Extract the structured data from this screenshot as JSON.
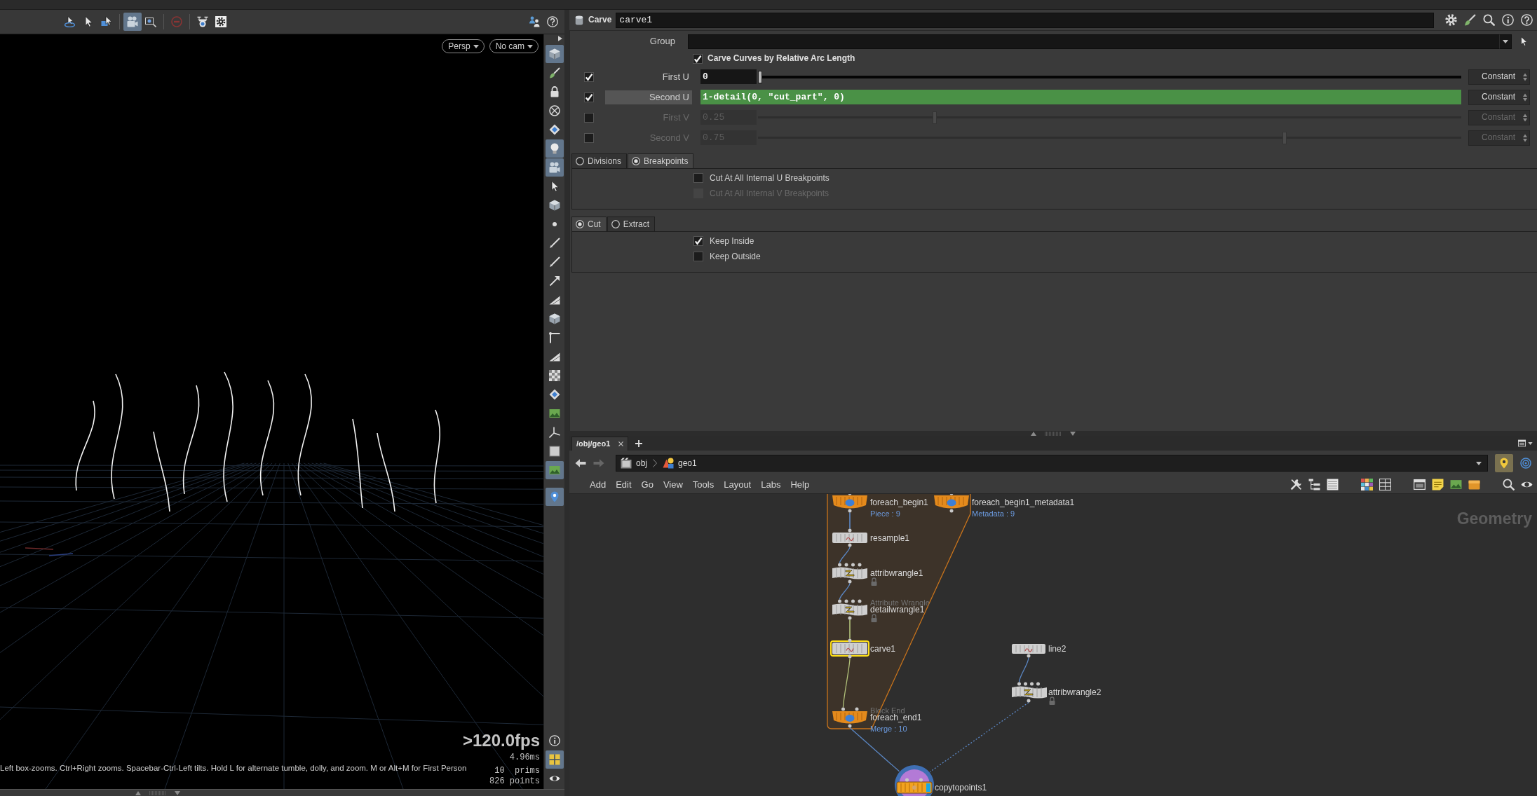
{
  "viewport": {
    "toolbar": [
      {
        "selected": false
      },
      {
        "selected": false
      },
      {
        "selected": false
      },
      {
        "selected": true
      },
      {
        "selected": false
      },
      {
        "selected": false
      },
      {
        "selected": false
      },
      {
        "selected": false
      },
      {
        "selected": false
      },
      {
        "selected": false
      }
    ],
    "view_menu": "Persp",
    "camera_menu": "No cam",
    "hint": "Left box-zooms. Ctrl+Right zooms. Spacebar-Ctrl-Left tilts. Hold L for alternate tumble, dolly, and zoom. M or Alt+M for First Person",
    "fps": ">120.0fps",
    "frame_time": "4.96ms",
    "prims": "10  prims",
    "points": "826 points",
    "side_toolbar": [
      {
        "selected": true
      },
      {
        "selected": false
      },
      {
        "selected": false
      },
      {
        "selected": false
      },
      {
        "selected": false
      },
      {
        "selected": true
      },
      {
        "selected": true
      },
      {
        "selected": false
      },
      {
        "selected": false
      },
      {
        "selected": false
      },
      {
        "selected": false
      },
      {
        "selected": false
      },
      {
        "selected": false
      },
      {
        "selected": false
      },
      {
        "selected": false
      },
      {
        "selected": false
      },
      {
        "selected": false
      },
      {
        "selected": false
      },
      {
        "selected": false
      },
      {
        "selected": false
      },
      {
        "selected": false
      },
      {
        "selected": false
      },
      {
        "selected": true
      },
      {
        "selected": true
      },
      {
        "selected": false
      },
      {
        "selected": true
      },
      {
        "selected": false
      }
    ]
  },
  "parameters": {
    "node_type": "Carve",
    "node_name": "carve1",
    "group": {
      "label": "Group"
    },
    "arc_length": {
      "label": "Carve Curves by Relative Arc Length",
      "checked": true
    },
    "rows": [
      {
        "label": "First U",
        "checked": true,
        "highlighted": false,
        "kind": "slider",
        "value": "0",
        "level": 0,
        "mode": "Constant"
      },
      {
        "label": "Second U",
        "checked": true,
        "highlighted": true,
        "kind": "expression",
        "value": "1-detail(0, \"cut_part\", 0)",
        "mode": "Constant"
      },
      {
        "label": "First V",
        "checked": false,
        "highlighted": false,
        "kind": "slider",
        "value": "0.25",
        "level": 0.25,
        "mode": "Constant"
      },
      {
        "label": "Second V",
        "checked": false,
        "highlighted": false,
        "kind": "slider",
        "value": "0.75",
        "level": 0.75,
        "mode": "Constant"
      }
    ],
    "domain_tabs": [
      {
        "label": "Divisions",
        "selected": false
      },
      {
        "label": "Breakpoints",
        "selected": true
      }
    ],
    "breakpoint_options": [
      {
        "label": "Cut At All Internal U Breakpoints",
        "checked": false,
        "disabled": false
      },
      {
        "label": "Cut At All Internal V Breakpoints",
        "checked": false,
        "disabled": true
      }
    ],
    "operation_tabs": [
      {
        "label": "Cut",
        "selected": true
      },
      {
        "label": "Extract",
        "selected": false
      }
    ],
    "keep_options": [
      {
        "label": "Keep Inside",
        "checked": true
      },
      {
        "label": "Keep Outside",
        "checked": false
      }
    ]
  },
  "network": {
    "tabs": [
      {
        "label": "/obj/geo1",
        "selected": true
      }
    ],
    "path": [
      "obj",
      "geo1"
    ],
    "menu": [
      "Add",
      "Edit",
      "Go",
      "View",
      "Tools",
      "Layout",
      "Labs",
      "Help"
    ],
    "context_label": "Geometry",
    "nodes": [
      {
        "name": "foreach_begin1",
        "kind": "block",
        "info": "Piece : 9",
        "selected": false,
        "display": false,
        "lock_badge": false
      },
      {
        "name": "foreach_begin1_metadata1",
        "kind": "block",
        "info": "Metadata : 9",
        "selected": false,
        "display": false,
        "lock_badge": false
      },
      {
        "name": "resample1",
        "kind": "sop",
        "selected": false,
        "display": false,
        "lock_badge": false
      },
      {
        "name": "attribwrangle1",
        "kind": "wrangle",
        "selected": false,
        "display": false,
        "lock_badge": true
      },
      {
        "name": "detailwrangle1",
        "kind": "wrangle",
        "type_label": "Attribute Wrangle",
        "selected": false,
        "display": false,
        "lock_badge": true
      },
      {
        "name": "carve1",
        "kind": "sop",
        "selected": true,
        "display": false,
        "lock_badge": false
      },
      {
        "name": "line2",
        "kind": "sop",
        "selected": false,
        "display": false,
        "lock_badge": false
      },
      {
        "name": "attribwrangle2",
        "kind": "wrangle",
        "selected": false,
        "display": false,
        "lock_badge": true
      },
      {
        "name": "foreach_end1",
        "kind": "block",
        "type_label": "Block End",
        "info": "Merge : 10",
        "selected": false,
        "display": false,
        "lock_badge": false
      },
      {
        "name": "copytopoints1",
        "kind": "copy",
        "selected": false,
        "display": true,
        "lock_badge": false
      }
    ],
    "wires": [
      {
        "dashed": false
      },
      {
        "dashed": false
      },
      {
        "dashed": false
      },
      {
        "dashed": false
      },
      {
        "dashed": false
      },
      {
        "dashed": false
      },
      {
        "dashed": false
      },
      {
        "dashed": true
      }
    ]
  }
}
